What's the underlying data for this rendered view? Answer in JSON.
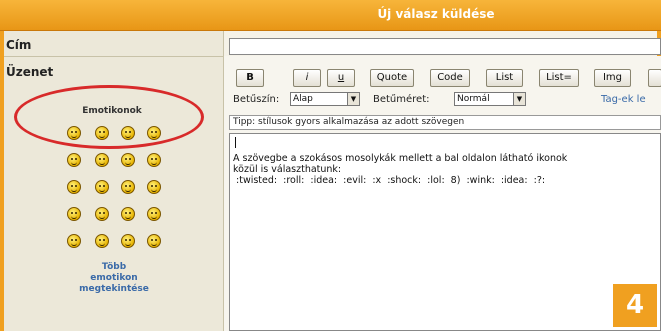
{
  "header": {
    "title": "Új válasz küldése"
  },
  "form": {
    "subject_label": "Cím",
    "message_label": "Üzenet",
    "subject_value": ""
  },
  "emoticons": {
    "title": "Emotikonok",
    "icons": [
      "sad-icon",
      "happy-icon",
      "grin-icon",
      "laugh-icon",
      "eek-icon",
      "smile-icon",
      "cool-icon",
      "lol-icon",
      "shock-icon",
      "cheerful-icon",
      "razz-icon",
      "wink-icon",
      "evil-icon",
      "twisted-icon",
      "rolleyes-icon",
      "mad-icon",
      "exclaim-icon",
      "question-icon",
      "idea-icon",
      "arrow-icon"
    ],
    "more_link": "Több\nemotikon\nmegtekintése"
  },
  "toolbar": {
    "buttons": [
      "B",
      "i",
      "u",
      "Quote",
      "Code",
      "List",
      "List=",
      "Img"
    ],
    "font_color_label": "Betűszín:",
    "font_color_value": "Alap",
    "font_size_label": "Betűméret:",
    "font_size_value": "Normál",
    "tags_link": "Tag-ek le"
  },
  "tip": "Tipp: stílusok gyors alkalmazása az adott szövegen",
  "message": {
    "line1": "A szövegbe a szokásos mosolykák mellett a bal oldalon látható ikonok",
    "line2": "közül is választhatunk:",
    "line3": " :twisted:  :roll:  :idea:  :evil:  :x  :shock:  :lol:  8)  :wink:  :idea:  :?:"
  },
  "badge": "4"
}
